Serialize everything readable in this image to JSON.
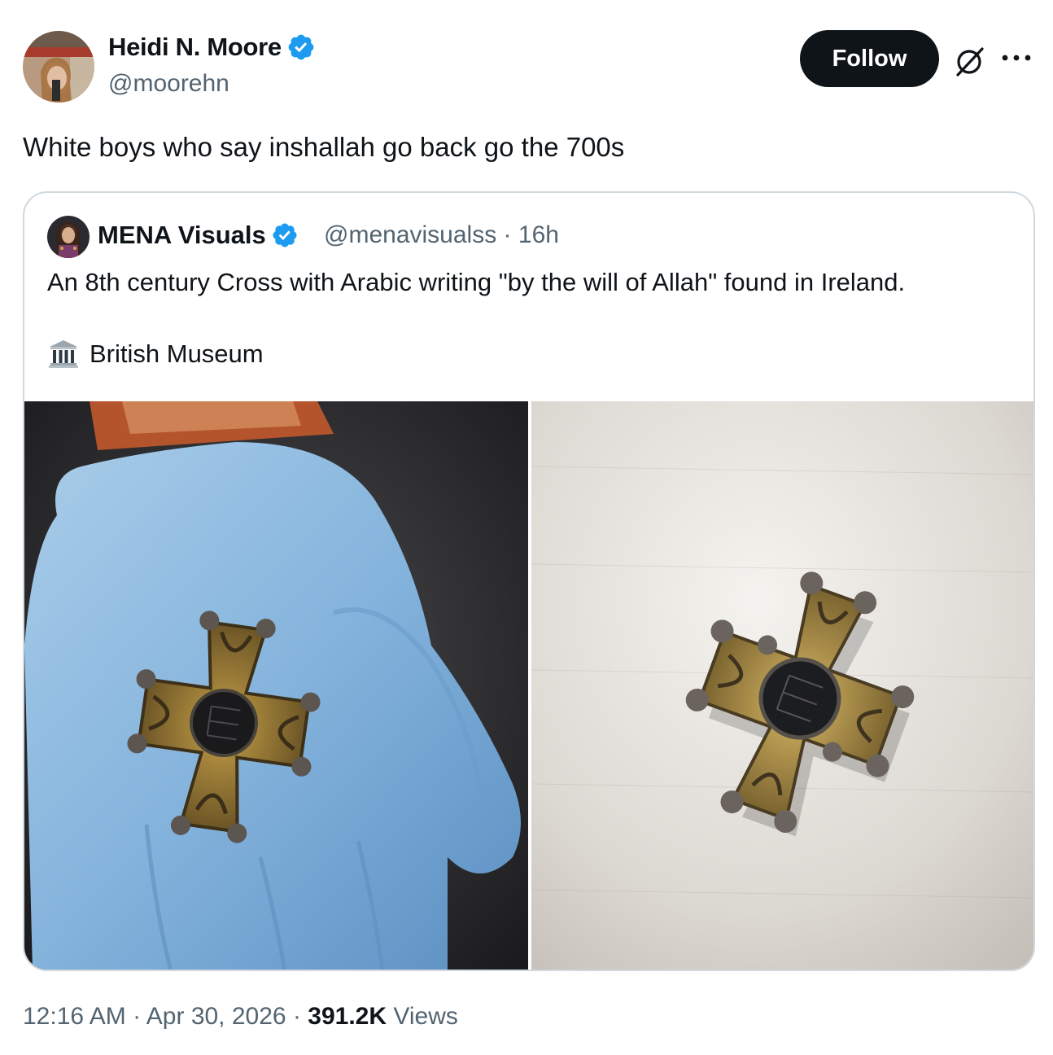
{
  "tweet": {
    "author": {
      "name": "Heidi N. Moore",
      "handle": "@moorehn",
      "verified": true
    },
    "follow_label": "Follow",
    "text": "White boys who say inshallah go back go the 700s",
    "icons": [
      "grok-icon",
      "more-icon",
      "verified-badge-icon"
    ],
    "footer": {
      "time": "12:16 AM",
      "date": "Apr 30, 2026",
      "views_count": "391.2K",
      "views_label": "Views",
      "separator": "·"
    }
  },
  "quote": {
    "author": {
      "name": "MENA Visuals",
      "handle": "@menavisualss",
      "age": "16h",
      "verified": true
    },
    "text": "An 8th century Cross with Arabic writing \"by the will of Allah\" found in Ireland.",
    "museum_label": "British Museum",
    "museum_icon": "classical-building-icon"
  },
  "colors": {
    "text_primary": "#0f1419",
    "text_secondary": "#536471",
    "verified_blue": "#1d9bf0",
    "border": "#cfd9de",
    "follow_bg": "#0f1419"
  }
}
